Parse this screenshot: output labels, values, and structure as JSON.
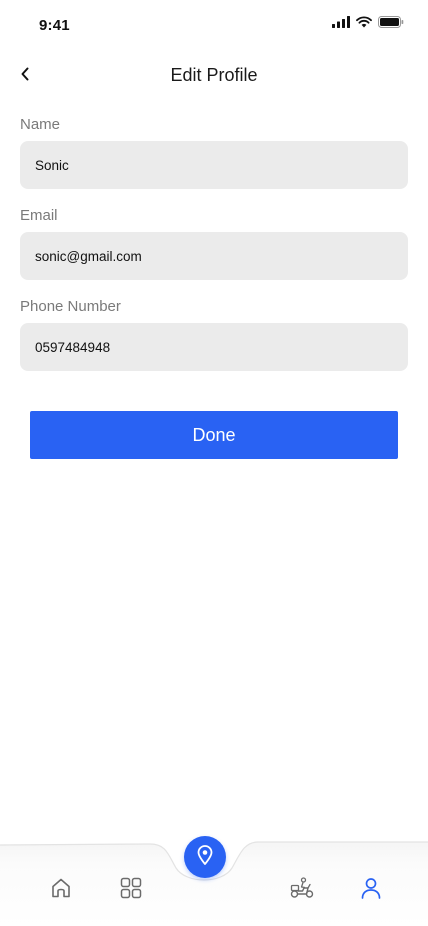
{
  "status_bar": {
    "time": "9:41"
  },
  "header": {
    "title": "Edit Profile"
  },
  "form": {
    "name": {
      "label": "Name",
      "value": "Sonic"
    },
    "email": {
      "label": "Email",
      "value": "sonic@gmail.com"
    },
    "phone": {
      "label": "Phone Number",
      "value": "0597484948"
    }
  },
  "done_label": "Done",
  "bottom_nav": {
    "items": [
      {
        "icon": "home-icon"
      },
      {
        "icon": "grid-icon"
      },
      {
        "icon": "location-pin-icon",
        "center": true
      },
      {
        "icon": "scooter-delivery-icon"
      },
      {
        "icon": "user-icon",
        "active": true
      }
    ]
  },
  "colors": {
    "accent": "#2962f3",
    "input_bg": "#ebebeb",
    "label": "#7a7a7a"
  }
}
